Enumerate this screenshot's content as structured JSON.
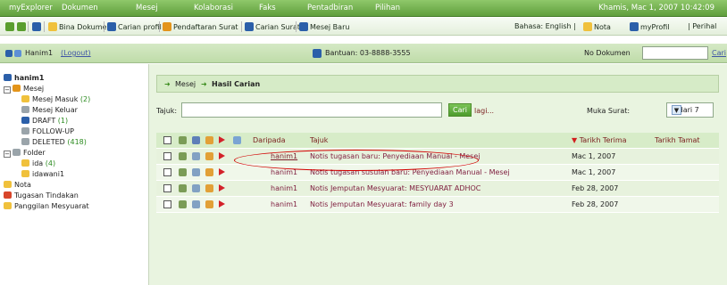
{
  "menu": [
    "myExplorer",
    "Dokumen",
    "Mesej",
    "Kolaborasi",
    "Faks",
    "Pentadbiran",
    "Pilihan"
  ],
  "datetime": "Khamis, Mac 1, 2007 10:42:09",
  "toolbar": {
    "items": [
      "Bina Dokumen",
      "Carian profil",
      "Pendaftaran Surat",
      "Carian Surat",
      "Mesej Baru"
    ],
    "right": "Bahasa: English | ",
    "nota": "Nota",
    "myprofil": "myProfil",
    "perihal": "| Perihal"
  },
  "subbar": {
    "user": "Hanim1",
    "logout": "(Logout)",
    "help": "Bantuan: 03-8888-3555",
    "doc_label": "No Dokumen",
    "doc_value": "",
    "cari": "Cari"
  },
  "sidebar": {
    "user": "hanim1",
    "root": "Mesej",
    "items": [
      {
        "label": "Mesej Masuk",
        "count": "(2)"
      },
      {
        "label": "Mesej Keluar",
        "count": ""
      },
      {
        "label": "DRAFT",
        "count": "(1)"
      },
      {
        "label": "FOLLOW-UP",
        "count": ""
      },
      {
        "label": "DELETED",
        "count": "(418)"
      }
    ],
    "folder_root": "Folder",
    "folders": [
      {
        "label": "ida",
        "count": "(4)"
      },
      {
        "label": "idawani1",
        "count": ""
      }
    ],
    "tail": [
      "Nota",
      "Tugasan Tindakan",
      "Panggilan Mesyuarat"
    ]
  },
  "breadcrumb": {
    "part1": "Mesej",
    "part2": "Hasil Carian"
  },
  "search": {
    "label": "Tajuk:",
    "value": "",
    "button": "Cari",
    "more": "lagi...",
    "page_label": "Muka Surat:",
    "page_value": "1 dari 7"
  },
  "table": {
    "headers": {
      "from": "Daripada",
      "subject": "Tajuk",
      "received": "Tarikh Terima",
      "due": "Tarikh Tamat"
    },
    "rows": [
      {
        "from": "hanim1",
        "subject": "Notis tugasan baru: Penyediaan Manual - Mesej",
        "received": "Mac 1, 2007",
        "due": ""
      },
      {
        "from": "hanim1",
        "subject": "Notis tugasan susulan baru: Penyediaan Manual - Mesej",
        "received": "Mac 1, 2007",
        "due": ""
      },
      {
        "from": "hanim1",
        "subject": "Notis Jemputan Mesyuarat: MESYUARAT ADHOC",
        "received": "Feb 28, 2007",
        "due": ""
      },
      {
        "from": "hanim1",
        "subject": "Notis Jemputan Mesyuarat: family day 3",
        "received": "Feb 28, 2007",
        "due": ""
      }
    ]
  }
}
